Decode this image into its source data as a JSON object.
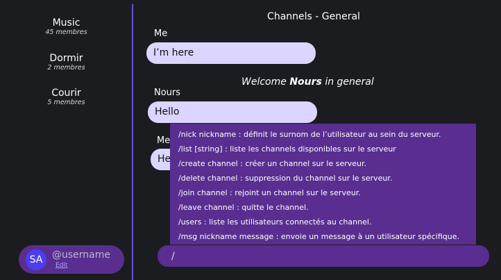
{
  "sidebar": {
    "channels": [
      {
        "name": "Music",
        "members": "45 membres"
      },
      {
        "name": "Dormir",
        "members": "2 membres"
      },
      {
        "name": "Courir",
        "members": "5 membres"
      }
    ],
    "user": {
      "initials": "SA",
      "username": "@username",
      "edit": "Edit"
    }
  },
  "header": {
    "title": "Channels -  General"
  },
  "messages": [
    {
      "sender": "Me",
      "text": "I’m here"
    },
    {
      "sender": "Nours",
      "text": "Hello"
    },
    {
      "sender": "Me",
      "text": "Hey"
    }
  ],
  "welcome": {
    "prefix": "Welcome",
    "name": "Nours",
    "suffix": "in general"
  },
  "commands": [
    "/nick nickname : définit le surnom de l’utilisateur au sein du serveur.",
    "/list [string] : liste les channels disponibles sur le serveur",
    "/create channel : créer un channel sur le serveur.",
    "/delete channel : suppression du channel sur le serveur.",
    "/join channel : rejoint un channel sur le serveur.",
    "/leave channel : quitte le channel.",
    "/users : liste les utilisateurs connectés au channel.",
    "/msg nickname message : envoie un message à un utilisateur spécifique."
  ],
  "input": {
    "value": "/"
  },
  "colors": {
    "background": "#1a1c1f",
    "accent": "#5a2e90",
    "divider": "#6b52d6",
    "bubble": "#dcd5ff",
    "avatar": "#4d3df0"
  }
}
